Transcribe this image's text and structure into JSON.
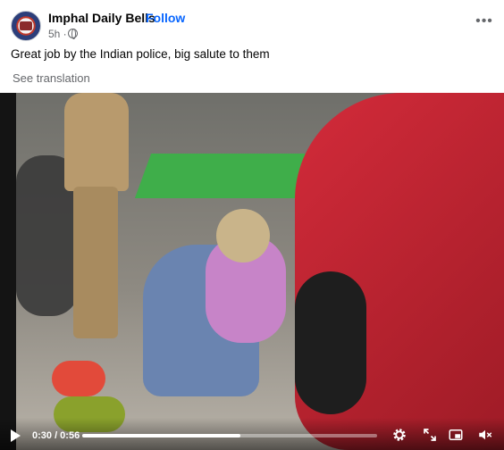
{
  "post": {
    "page_name": "Imphal Daily Bells",
    "separator": "·",
    "follow_label": "Follow",
    "time": "5h ·",
    "more_icon": "more-options-icon",
    "caption": "Great job by the Indian police, big salute to them",
    "see_translation": "See translation"
  },
  "video": {
    "current_time": "0:30 / 0:56",
    "progress": 0.536,
    "icons": [
      "play-icon",
      "settings-gear-icon",
      "fullscreen-expand-icon",
      "picture-in-picture-icon",
      "mute-speaker-icon"
    ]
  },
  "colors": {
    "accent": "#0866ff",
    "secondary_text": "#65676b",
    "car_red": "#d32b3a"
  }
}
